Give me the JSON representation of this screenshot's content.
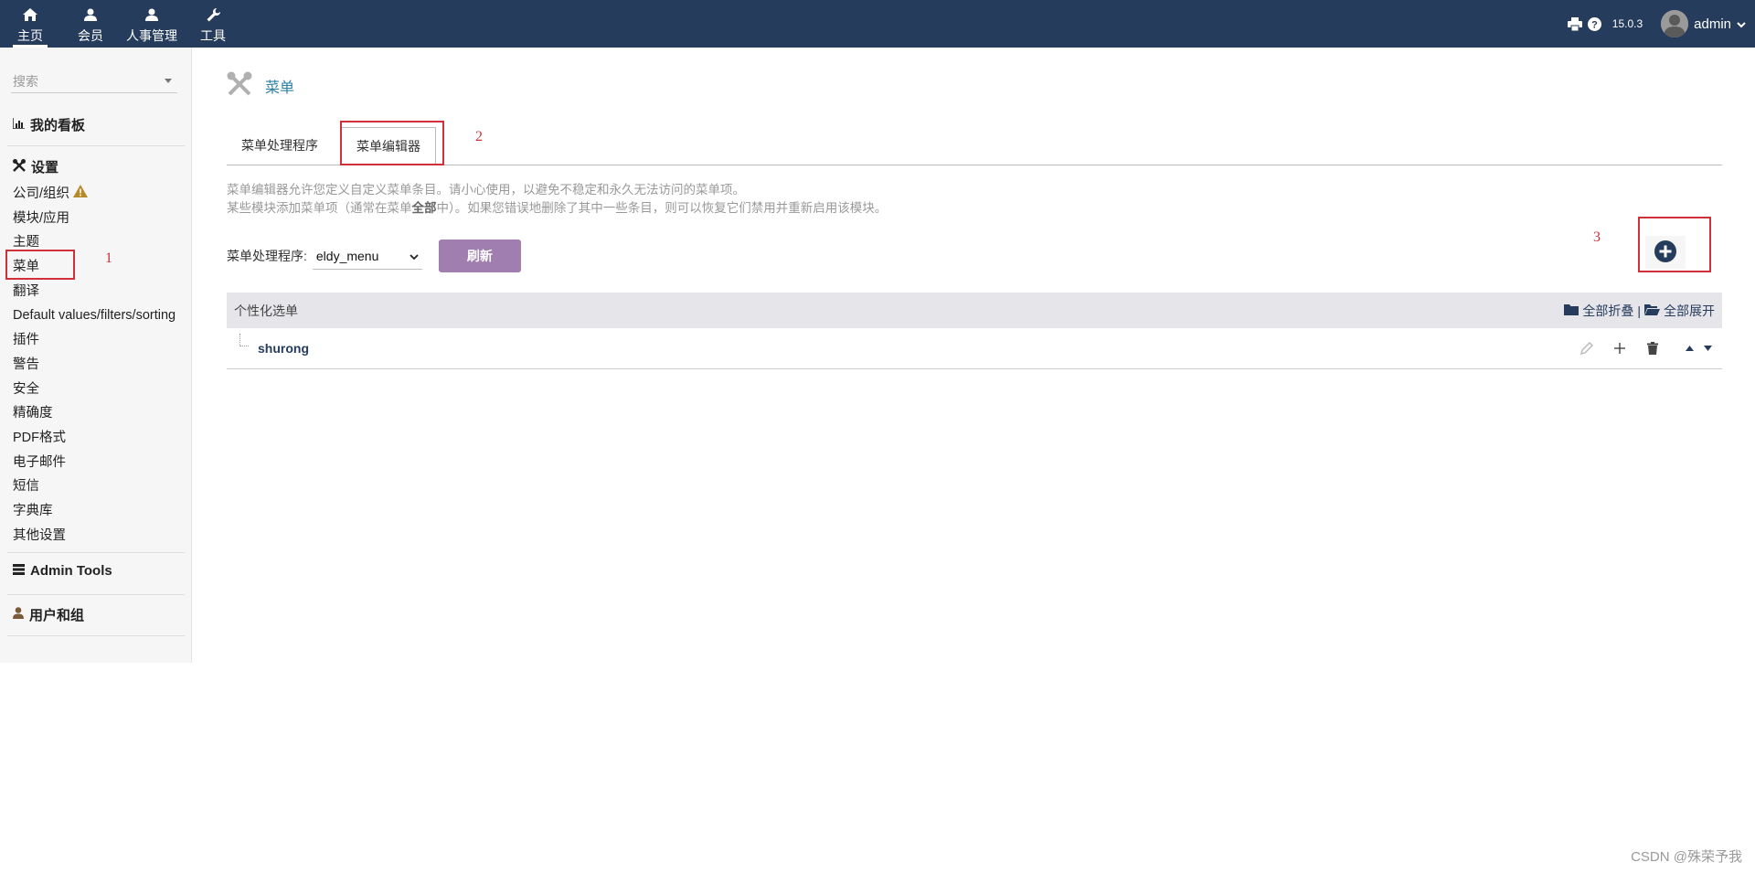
{
  "topnav": {
    "items": [
      {
        "label": "主页",
        "icon": "home-icon"
      },
      {
        "label": "会员",
        "icon": "user-icon"
      },
      {
        "label": "人事管理",
        "icon": "user-icon"
      },
      {
        "label": "工具",
        "icon": "wrench-icon"
      }
    ],
    "version": "15.0.3",
    "username": "admin"
  },
  "sidebar": {
    "search_placeholder": "搜索",
    "dashboard_label": "我的看板",
    "settings_label": "设置",
    "items": [
      "公司/组织",
      "模块/应用",
      "主题",
      "菜单",
      "翻译",
      "Default values/filters/sorting",
      "插件",
      "警告",
      "安全",
      "精确度",
      "PDF格式",
      "电子邮件",
      "短信",
      "字典库",
      "其他设置"
    ],
    "admin_tools_label": "Admin Tools",
    "users_groups_label": "用户和组"
  },
  "page": {
    "title": "菜单",
    "tabs": [
      "菜单处理程序",
      "菜单编辑器"
    ],
    "active_tab": "菜单编辑器",
    "desc_line1": "菜单编辑器允许您定义自定义菜单条目。请小心使用，以避免不稳定和永久无法访问的菜单项。",
    "desc_line2_a": "某些模块添加菜单项（通常在菜单",
    "desc_line2_bold": "全部",
    "desc_line2_b": "中）。如果您错误地删除了其中一些条目，则可以恢复它们禁用并重新启用该模块。",
    "handler_label": "菜单处理程序:",
    "handler_value": "eldy_menu",
    "refresh_label": "刷新"
  },
  "table": {
    "header": "个性化选单",
    "collapse_all": "全部折叠",
    "separator": "|",
    "expand_all": "全部展开",
    "rows": [
      {
        "label": "shurong"
      }
    ]
  },
  "annotations": [
    "1",
    "2",
    "3"
  ],
  "watermark": "CSDN @殊荣予我",
  "colors": {
    "topbar": "#263c5c",
    "refresh_button": "#a07fb0",
    "link": "#263c5c",
    "annotation": "#d0303a"
  }
}
